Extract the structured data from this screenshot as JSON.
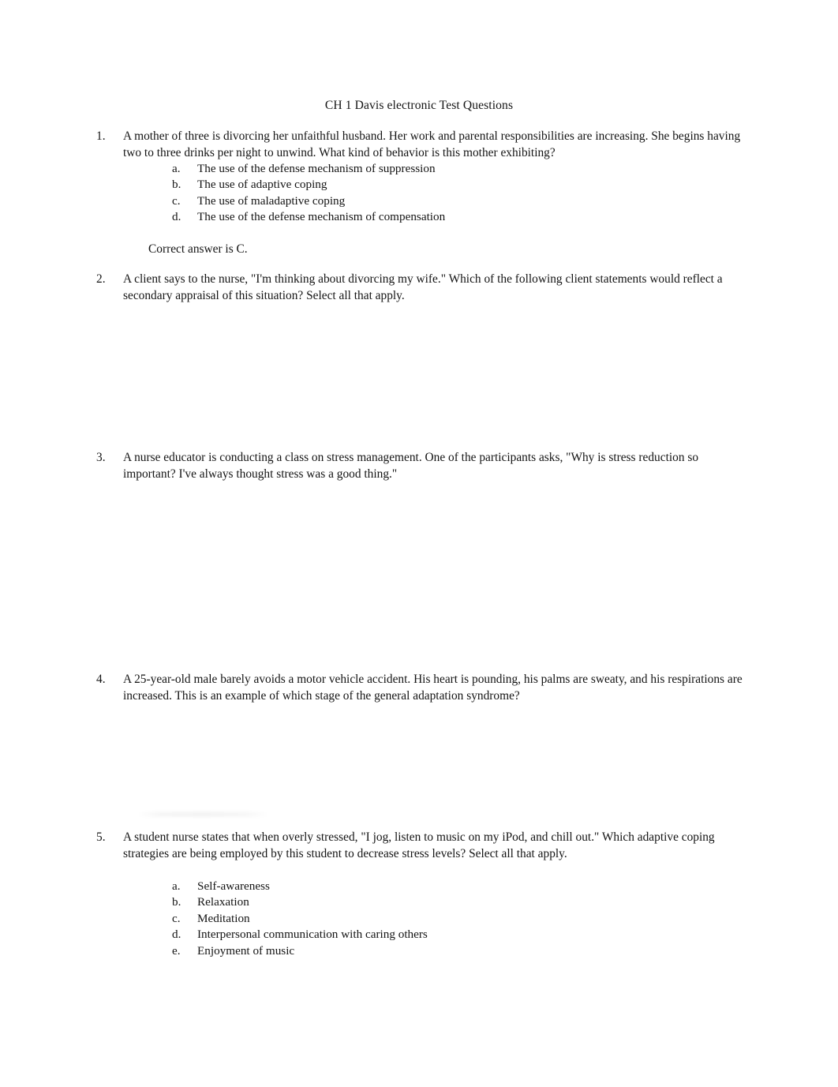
{
  "document": {
    "title": "CH 1 Davis electronic Test Questions",
    "questions": [
      {
        "number": "1.",
        "text": "A mother of three is divorcing her unfaithful husband. Her work and parental responsibilities are increasing. She begins having two to three drinks per night to unwind. What kind of behavior is this mother exhibiting?",
        "options": [
          {
            "letter": "a.",
            "label": "The use of the defense mechanism of suppression"
          },
          {
            "letter": "b.",
            "label": "The use of adaptive coping"
          },
          {
            "letter": "c.",
            "label": "The use of maladaptive coping"
          },
          {
            "letter": "d.",
            "label": "The use of the defense mechanism of compensation"
          }
        ],
        "answer_note": "Correct answer is C."
      },
      {
        "number": "2.",
        "text": "A client says to the nurse, \"I'm thinking about divorcing my wife.\" Which of the following client statements would reflect a secondary appraisal of this situation? Select all that apply.",
        "options": [],
        "answer_note": ""
      },
      {
        "number": "3.",
        "text": "A nurse educator is conducting a class on stress management. One of the participants asks, \"Why is stress reduction so important? I've always thought stress was a good thing.\"",
        "options": [],
        "answer_note": ""
      },
      {
        "number": "4.",
        "text": "A 25-year-old male barely avoids a motor vehicle accident. His heart is pounding, his palms are sweaty, and his respirations are increased. This is an example of which stage of the general adaptation syndrome?",
        "options": [],
        "answer_note": ""
      },
      {
        "number": "5.",
        "text": "A student nurse states that when overly stressed, \"I jog, listen to music on my iPod, and chill out.\" Which adaptive coping strategies are being employed by this student to decrease stress levels? Select all that apply.",
        "options": [
          {
            "letter": "a.",
            "label": "Self-awareness"
          },
          {
            "letter": "b.",
            "label": "Relaxation"
          },
          {
            "letter": "c.",
            "label": "Meditation"
          },
          {
            "letter": "d.",
            "label": "Interpersonal communication with caring others"
          },
          {
            "letter": "e.",
            "label": "Enjoyment of music"
          }
        ],
        "answer_note": ""
      }
    ]
  }
}
